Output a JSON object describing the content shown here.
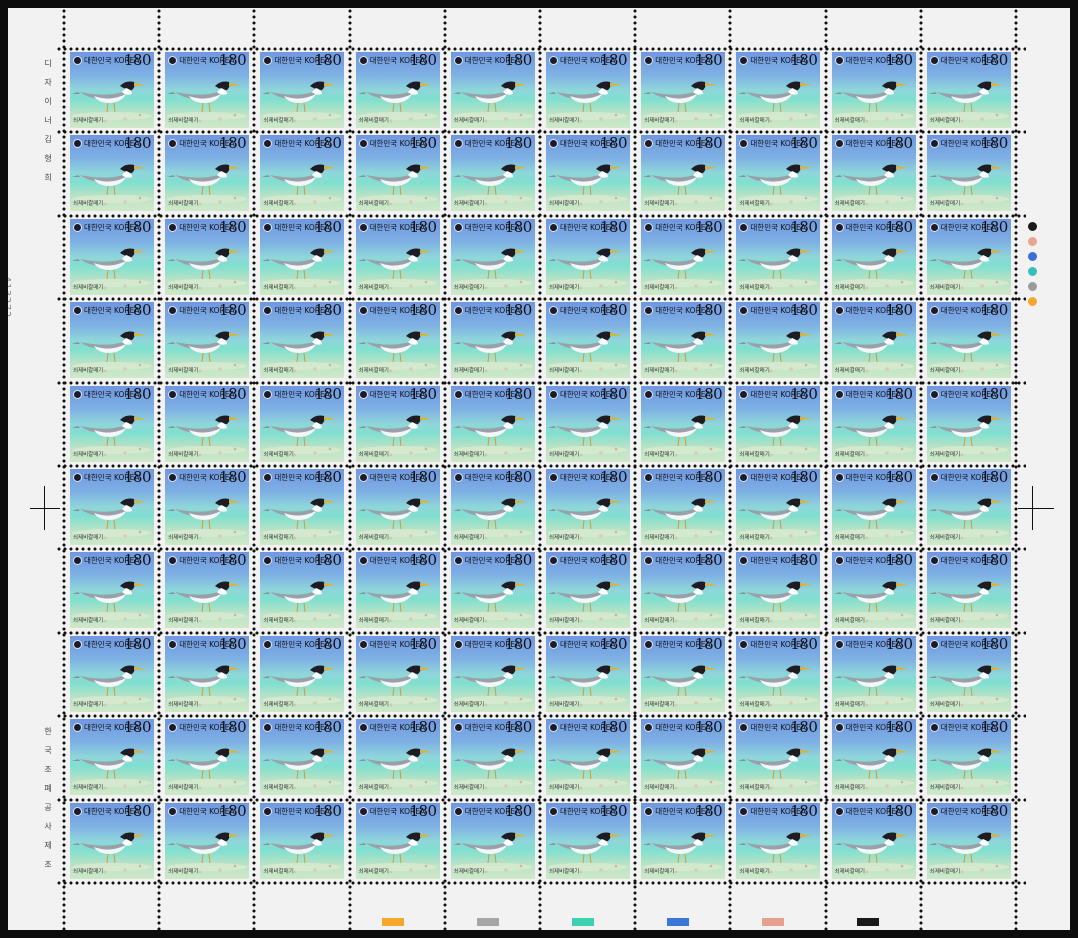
{
  "stamp": {
    "country": "대한민국 KOREA",
    "denomination": "180",
    "species_name": "쇠제비갈매기",
    "rows": 10,
    "cols": 10
  },
  "margins": {
    "left_top_inscription": "디자이너 김 형 희",
    "left_bottom_inscription": "한국조폐공사제조",
    "serial_number": "413272"
  },
  "color_dots": [
    "#1a1a1a",
    "#e8a58f",
    "#3a6fd8",
    "#33c0b8",
    "#9a9a9a",
    "#f4a72a"
  ],
  "color_bars": [
    "#f4a72a",
    "#a6a6a6",
    "#3fd0b0",
    "#3a78d8",
    "#e6a090",
    "#1a1a1a"
  ]
}
